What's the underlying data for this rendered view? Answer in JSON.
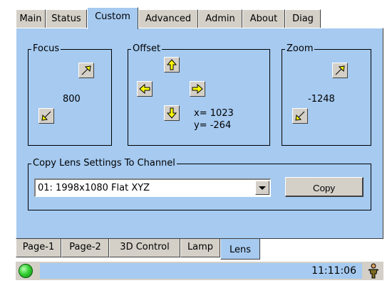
{
  "top_tabs": [
    {
      "label": "Main"
    },
    {
      "label": "Status"
    },
    {
      "label": "Custom"
    },
    {
      "label": "Advanced"
    },
    {
      "label": "Admin"
    },
    {
      "label": "About"
    },
    {
      "label": "Diag"
    }
  ],
  "active_top_tab": "Custom",
  "focus": {
    "title": "Focus",
    "value": "800",
    "up_icon": "arrow-up-right-icon",
    "down_icon": "arrow-down-left-icon"
  },
  "offset": {
    "title": "Offset",
    "x_label": "x= 1023",
    "y_label": "y= -264"
  },
  "zoom": {
    "title": "Zoom",
    "value": "-1248"
  },
  "copy_lens": {
    "title": "Copy Lens Settings To Channel",
    "selected_channel": "01: 1998x1080  Flat XYZ",
    "copy_label": "Copy"
  },
  "bottom_tabs": [
    {
      "label": "Page-1"
    },
    {
      "label": "Page-2"
    },
    {
      "label": "3D Control"
    },
    {
      "label": "Lamp"
    },
    {
      "label": "Lens"
    }
  ],
  "active_bottom_tab": "Lens",
  "status": {
    "time": "11:11:06",
    "indicator_color": "#35d035"
  },
  "colors": {
    "panel": "#a6caf0",
    "button_face": "#d4d0c8",
    "arrow_fill": "#ffff00"
  }
}
